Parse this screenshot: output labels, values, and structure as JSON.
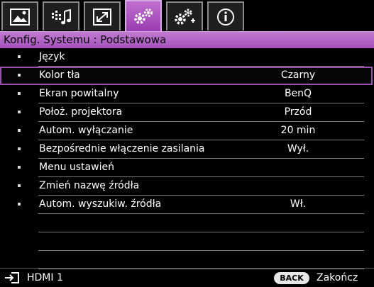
{
  "tabs": [
    {
      "icon": "picture-icon"
    },
    {
      "icon": "audio-settings-icon"
    },
    {
      "icon": "display-icon"
    },
    {
      "icon": "system-setup-basic-icon",
      "active": true
    },
    {
      "icon": "system-setup-advanced-icon"
    },
    {
      "icon": "information-icon"
    }
  ],
  "header": {
    "title": "Konfig. Systemu : Podstawowa"
  },
  "menu": {
    "items": [
      {
        "label": "Język",
        "value": ""
      },
      {
        "label": "Kolor tła",
        "value": "Czarny"
      },
      {
        "label": "Ekran powitalny",
        "value": "BenQ"
      },
      {
        "label": "Położ. projektora",
        "value": "Przód"
      },
      {
        "label": "Autom. wyłączanie",
        "value": "20 min"
      },
      {
        "label": "Bezpośrednie włączenie zasilania",
        "value": "Wył."
      },
      {
        "label": "Menu ustawień",
        "value": ""
      },
      {
        "label": "Zmień nazwę źródła",
        "value": ""
      },
      {
        "label": "Autom. wyszukiw. źródła",
        "value": "Wł."
      }
    ],
    "selected_index": 1
  },
  "footer": {
    "source_icon": "input-source-icon",
    "source": "HDMI 1",
    "back_label": "BACK",
    "exit_label": "Zakończ"
  },
  "colors": {
    "accent": "#a552bc",
    "selection_border": "#9a4fb2",
    "background": "#000000"
  }
}
